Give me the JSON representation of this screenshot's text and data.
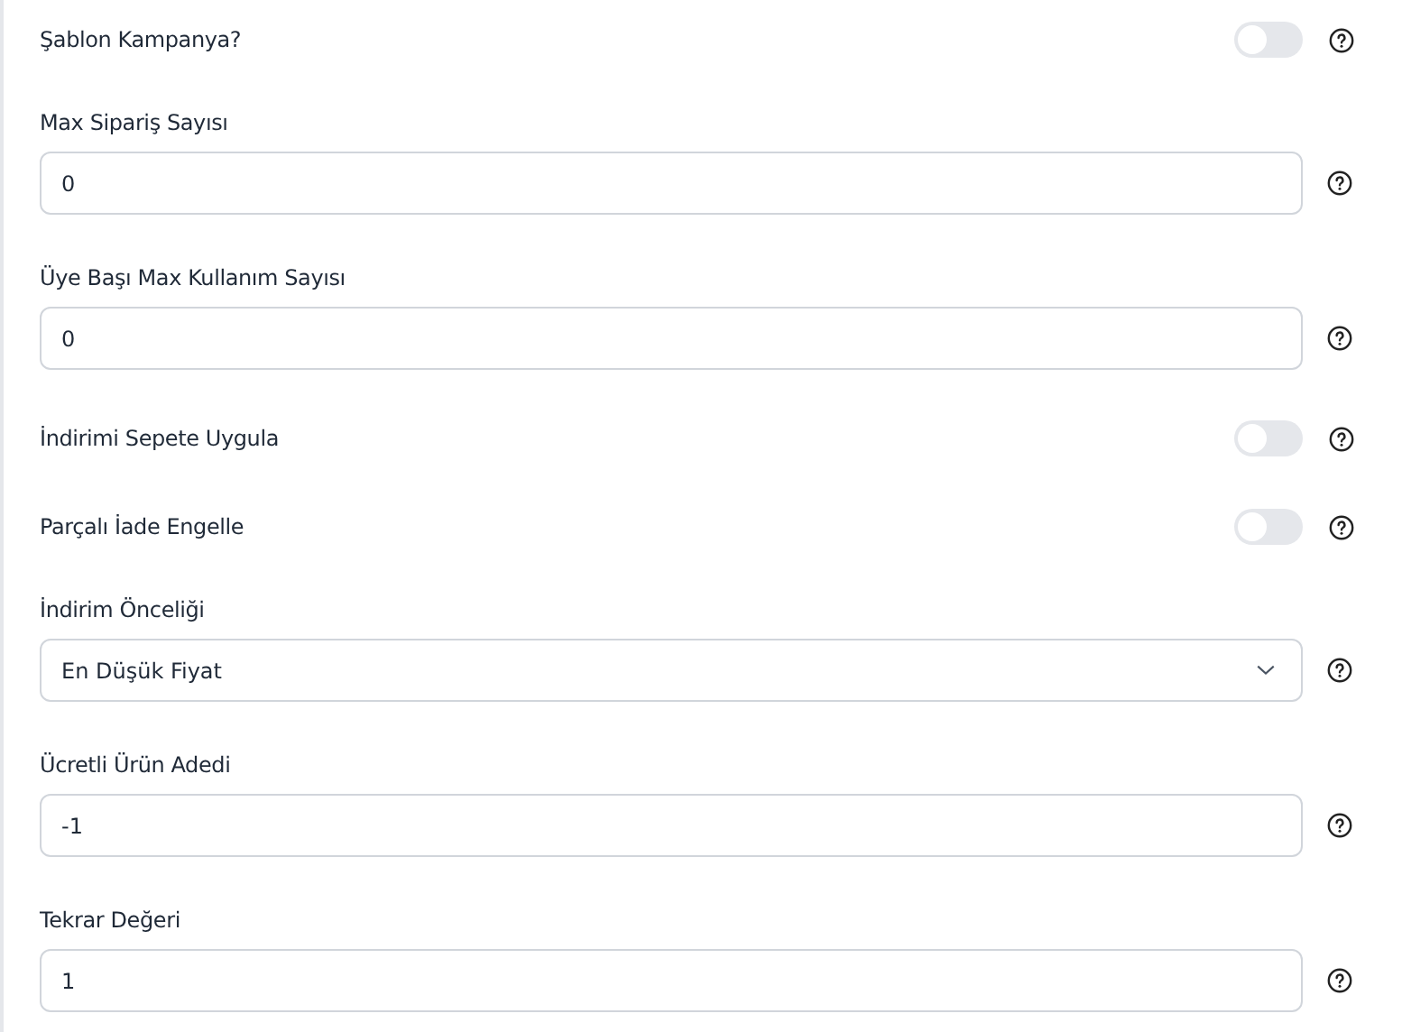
{
  "fields": [
    {
      "kind": "toggle",
      "label": "Şablon Kampanya?",
      "on": false
    },
    {
      "kind": "input",
      "label": "Max Sipariş Sayısı",
      "value": "0"
    },
    {
      "kind": "input",
      "label": "Üye Başı Max Kullanım Sayısı",
      "value": "0"
    },
    {
      "kind": "toggle",
      "label": "İndirimi Sepete Uygula",
      "on": false
    },
    {
      "kind": "toggle",
      "label": "Parçalı İade Engelle",
      "on": false
    },
    {
      "kind": "select",
      "label": "İndirim Önceliği",
      "value": "En Düşük Fiyat"
    },
    {
      "kind": "input",
      "label": "Ücretli Ürün Adedi",
      "value": "-1"
    },
    {
      "kind": "input",
      "label": "Tekrar Değeri",
      "value": "1"
    }
  ]
}
